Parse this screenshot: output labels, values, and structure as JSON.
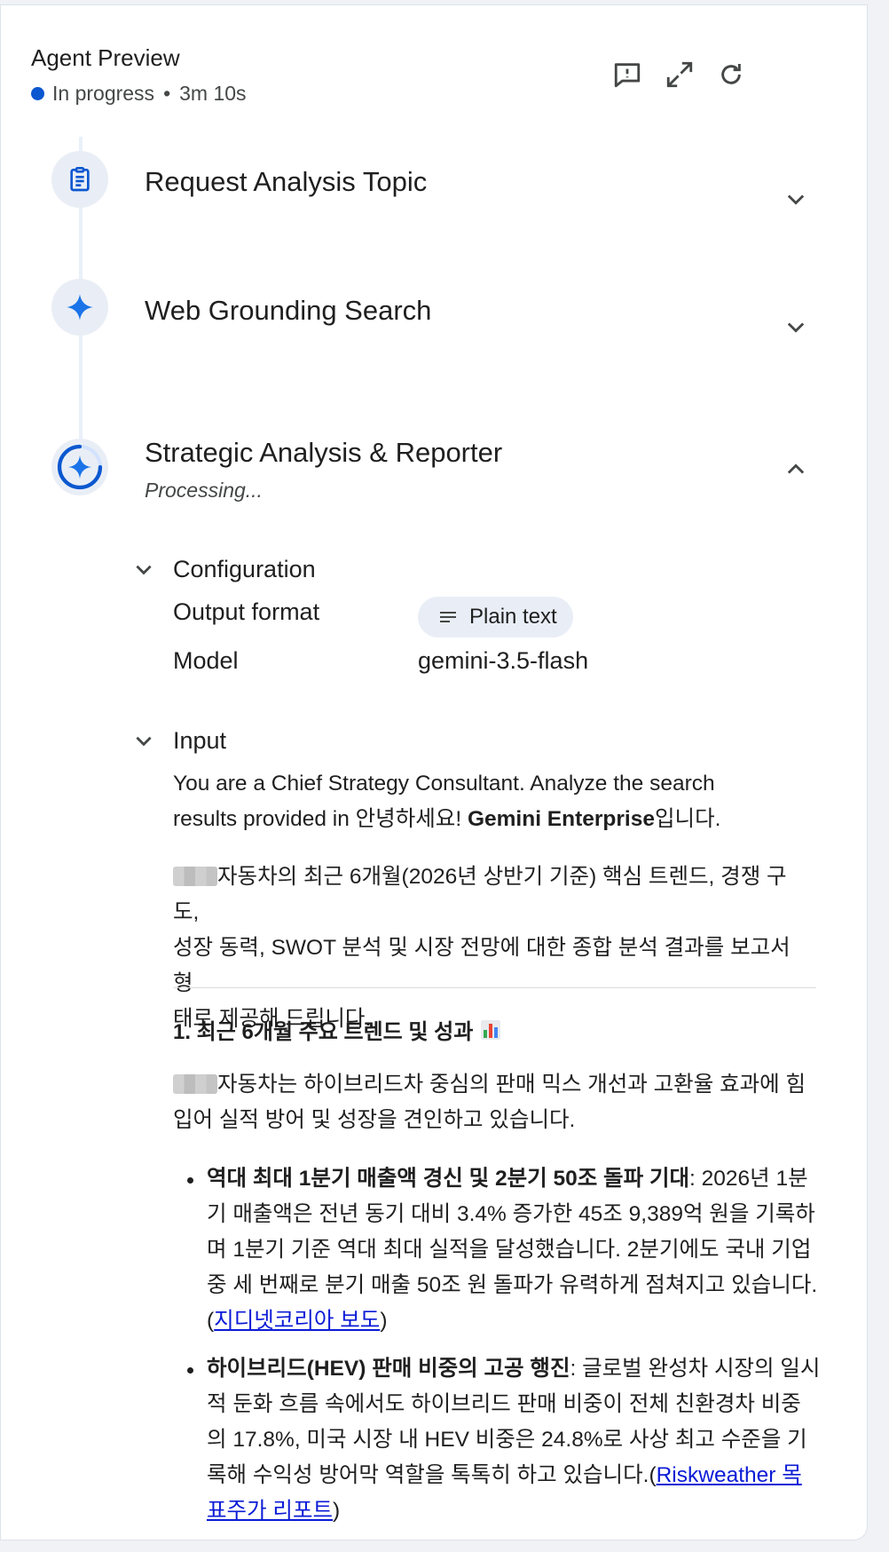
{
  "header": {
    "title": "Agent Preview",
    "status": "In progress",
    "separator": "•",
    "elapsed": "3m 10s",
    "status_color": "#0b57d0"
  },
  "toolbar_icons": [
    "feedback-icon",
    "expand-icon",
    "refresh-icon"
  ],
  "steps": [
    {
      "title": "Request Analysis Topic",
      "icon": "clipboard-icon",
      "expanded": false
    },
    {
      "title": "Web Grounding Search",
      "icon": "sparkle-icon",
      "expanded": false
    },
    {
      "title": "Strategic Analysis & Reporter",
      "icon": "sparkle-spinner-icon",
      "status": "Processing...",
      "expanded": true
    }
  ],
  "configuration": {
    "title": "Configuration",
    "output_format_label": "Output format",
    "output_format_value": "Plain text",
    "model_label": "Model",
    "model_value": "gemini-3.5-flash"
  },
  "input": {
    "title": "Input",
    "intro_line1": "You are a Chief Strategy Consultant. Analyze the search",
    "intro_line2_prefix": "results provided in 안녕하세요! ",
    "intro_line2_bold": "Gemini Enterprise",
    "intro_line2_suffix": "입니다.",
    "para1_line1": "자동차의 최근 6개월(2026년 상반기 기준) 핵심 트렌드, 경쟁 구도,",
    "para1_line2": "성장 동력, SWOT 분석 및 시장 전망에 대한 종합 분석 결과를 보고서 형",
    "para1_line3": "태로 제공해 드립니다.",
    "section1_heading": "1. 최근 6개월 주요 트렌드 및 성과",
    "section1_emoji": "📊",
    "para2_line1": "자동차는 하이브리드차 중심의 판매 믹스 개선과 고환율 효과에 힘",
    "para2_line2": "입어 실적 방어 및 성장을 견인하고 있습니다.",
    "bullets": [
      {
        "bold": "역대 최대 1분기 매출액 경신 및 2분기 50조 돌파 기대",
        "text": ": 2026년 1분기 매출액은 전년 동기 대비 3.4% 증가한 45조 9,389억 원을 기록하며 1분기 기준 역대 최대 실적을 달성했습니다. 2분기에도 국내 기업 중 세 번째로 분기 매출 50조 원 돌파가 유력하게 점쳐지고 있습니다.(",
        "link": "지디넷코리아 보도",
        "close": ")"
      },
      {
        "bold": "하이브리드(HEV) 판매 비중의 고공 행진",
        "text": ": 글로벌 완성차 시장의 일시적 둔화 흐름 속에서도 하이브리드 판매 비중이 전체 친환경차 비중의 17.8%, 미국 시장 내 HEV 비중은 24.8%로 사상 최고 수준을 기록해 수익성 방어막 역할을 톡톡히 하고 있습니다.(",
        "link": "Riskweather 목표주가 리포트",
        "close": ")"
      }
    ]
  }
}
